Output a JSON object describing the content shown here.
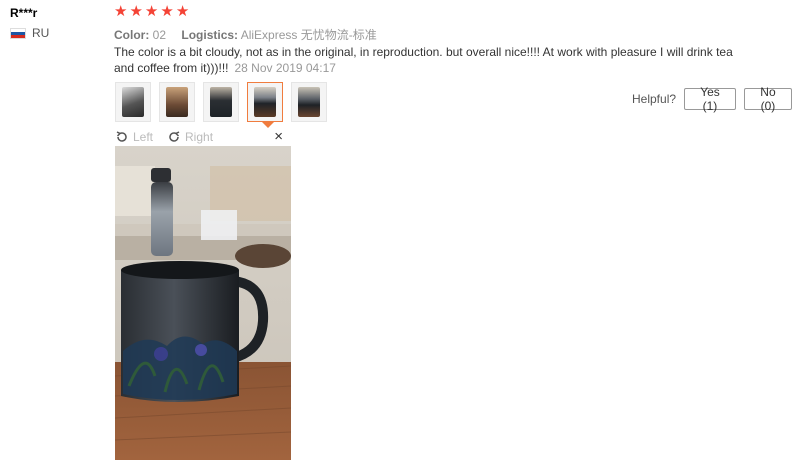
{
  "reviewer": {
    "name": "R***r",
    "country": "RU"
  },
  "rating": {
    "value": 5,
    "max": 5,
    "star_color": "#f44336"
  },
  "meta": {
    "color_label": "Color:",
    "color_value": "02",
    "logistics_label": "Logistics:",
    "logistics_value": "AliExpress 无忧物流-标准"
  },
  "review": {
    "text": "The color is a bit cloudy, not as in the original, in reproduction. but overall nice!!!! At work with pleasure I will drink tea and coffee from it)))!!!",
    "date": "28 Nov 2019 04:17"
  },
  "thumbnails": {
    "count": 5,
    "active_index": 3
  },
  "helpful": {
    "label": "Helpful?",
    "yes_label": "Yes (1)",
    "no_label": "No (0)"
  },
  "viewer": {
    "left_label": "Left",
    "right_label": "Right",
    "close_symbol": "×"
  },
  "icons": {
    "flag": "russia-flag-icon",
    "rotate_left": "rotate-left-icon",
    "rotate_right": "rotate-right-icon",
    "close": "close-icon"
  },
  "colors": {
    "accent": "#f07c3e",
    "text": "#333333",
    "muted": "#999999"
  }
}
